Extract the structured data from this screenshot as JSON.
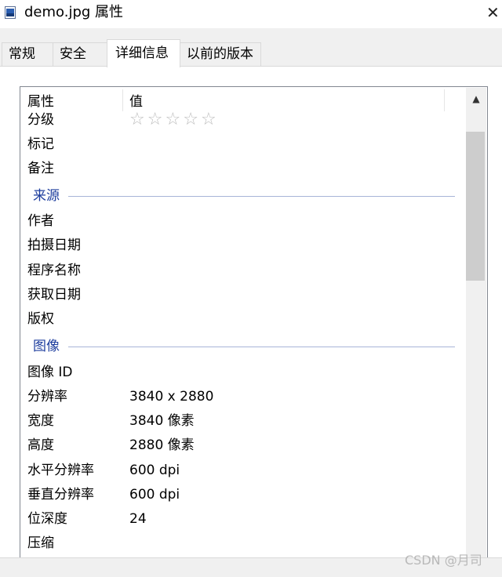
{
  "window": {
    "title": "demo.jpg 属性",
    "close_glyph": "✕"
  },
  "tabs": [
    {
      "label": "常规",
      "active": false
    },
    {
      "label": "安全",
      "active": false
    },
    {
      "label": "详细信息",
      "active": true
    },
    {
      "label": "以前的版本",
      "active": false
    }
  ],
  "columns": {
    "property": "属性",
    "value": "值"
  },
  "rows": {
    "rating": {
      "label": "分级",
      "stars_total": 5,
      "stars_filled": 0
    },
    "tags": {
      "label": "标记",
      "value": ""
    },
    "comments": {
      "label": "备注",
      "value": ""
    }
  },
  "groups": {
    "origin": "来源",
    "image": "图像"
  },
  "origin_rows": [
    {
      "label": "作者",
      "value": ""
    },
    {
      "label": "拍摄日期",
      "value": ""
    },
    {
      "label": "程序名称",
      "value": ""
    },
    {
      "label": "获取日期",
      "value": ""
    },
    {
      "label": "版权",
      "value": ""
    }
  ],
  "image_rows": [
    {
      "label": "图像 ID",
      "value": ""
    },
    {
      "label": "分辨率",
      "value": "3840 x 2880"
    },
    {
      "label": "宽度",
      "value": "3840 像素"
    },
    {
      "label": "高度",
      "value": "2880 像素"
    },
    {
      "label": "水平分辨率",
      "value": "600 dpi"
    },
    {
      "label": "垂直分辨率",
      "value": "600 dpi"
    },
    {
      "label": "位深度",
      "value": "24"
    },
    {
      "label": "压缩",
      "value": ""
    }
  ],
  "watermark": "CSDN @月司",
  "colors": {
    "group_label": "#1e3e9e",
    "group_line": "#a8b4d8",
    "star": "#bdbdbd"
  }
}
